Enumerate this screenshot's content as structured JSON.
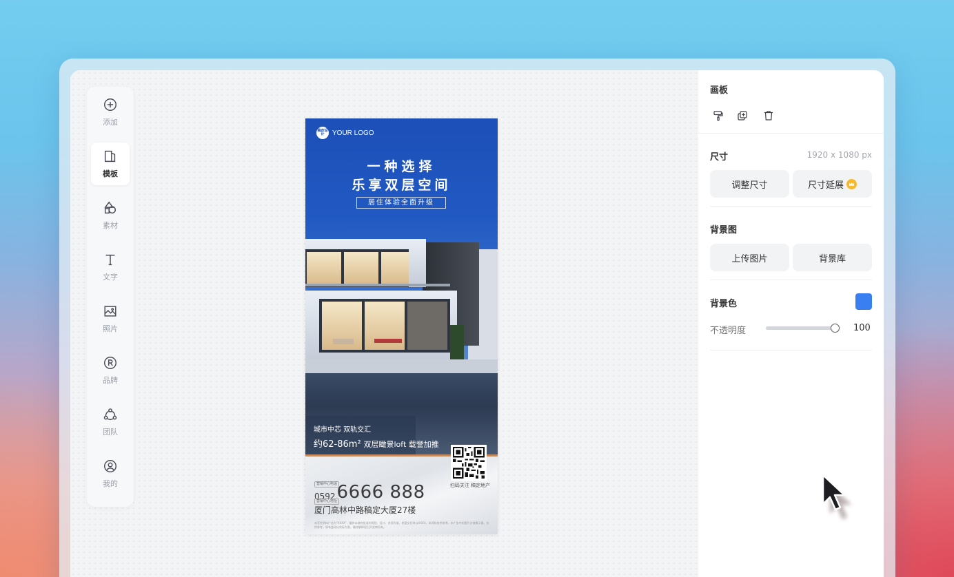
{
  "toolbar": {
    "items": [
      {
        "label": "添加",
        "icon": "plus-circle-icon"
      },
      {
        "label": "模板",
        "icon": "template-icon",
        "active": true
      },
      {
        "label": "素材",
        "icon": "shapes-icon"
      },
      {
        "label": "文字",
        "icon": "text-icon"
      },
      {
        "label": "照片",
        "icon": "image-icon"
      },
      {
        "label": "品牌",
        "icon": "registered-icon"
      },
      {
        "label": "团队",
        "icon": "team-icon"
      },
      {
        "label": "我的",
        "icon": "user-icon"
      }
    ]
  },
  "poster": {
    "logo_badge": "稿定设计",
    "logo_text": "YOUR LOGO",
    "headline_1": "一种选择",
    "headline_2": "乐享双层空间",
    "subheadline": "居住体验全面升级",
    "feature_1": "城市中芯 双轨交汇",
    "feature_2_size": "约62-86m²",
    "feature_2_rest": "双层瞰景loft 载誉加推",
    "qr_caption": "扫码关注 稿定地产",
    "tag_1": "营销中心电话",
    "tag_2": "营销中心地址",
    "phone_prefix": "0592",
    "phone_number": "6666 888",
    "address": "厦门高林中路稿定大厦27楼",
    "fine_print": "本宣传资料广告为\"XXXX\"，最终以政府批准的规划、设计、合同为准，房屋交付时以XXXX，本资料仅供参考。本广告中的图片为效果示意，仅供参考，如有变动以实际为准，最终解释权归开发商所有。"
  },
  "panel": {
    "artboard_title": "画板",
    "artboard_icons": [
      "format-painter-icon",
      "duplicate-icon",
      "trash-icon"
    ],
    "size_title": "尺寸",
    "size_value": "1920 x 1080 px",
    "resize_button": "调整尺寸",
    "extend_button": "尺寸延展",
    "bg_image_title": "背景图",
    "upload_button": "上传图片",
    "library_button": "背景库",
    "bg_color_title": "背景色",
    "bg_color": "#3a7ff2",
    "opacity_label": "不透明度",
    "opacity_value": "100"
  },
  "colors": {
    "poster_blue": "#1d4fb8",
    "accent_gold": "#f4b92c",
    "copper_line": "#c98a5e"
  }
}
